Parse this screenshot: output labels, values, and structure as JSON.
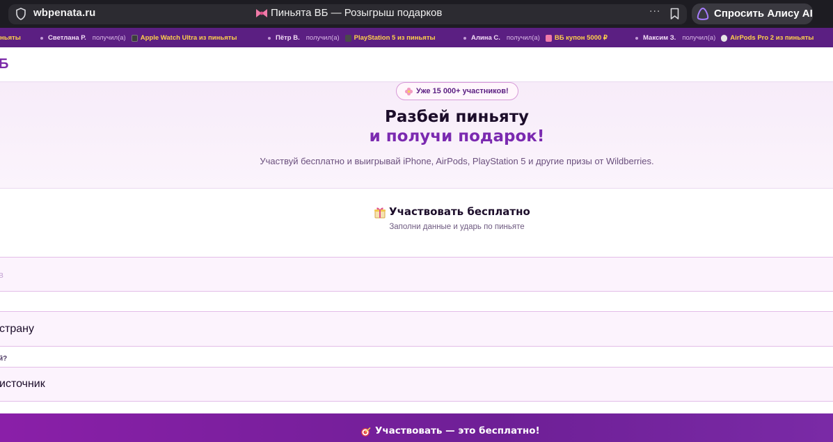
{
  "browser": {
    "url": "wbpenata.ru",
    "tab_title": "Пиньята ВБ — Розыгрыш подарков",
    "menu_dots": "···",
    "alice_button": "Спросить Алису AI"
  },
  "ticker": {
    "first_prize_fragment": "ньяты",
    "items": [
      {
        "name": "Светлана Р.",
        "action": "получил(а)",
        "prize": "Apple Watch Ultra из пиньяты",
        "icon": "watch-icon"
      },
      {
        "name": "Пётр В.",
        "action": "получил(а)",
        "prize": "PlayStation 5 из пиньяты",
        "icon": "gamepad-icon"
      },
      {
        "name": "Алина С.",
        "action": "получил(а)",
        "prize": "ВБ купон 5000 ₽",
        "icon": "shopping-bag-icon"
      },
      {
        "name": "Максим З.",
        "action": "получил(а)",
        "prize": "AirPods Pro 2 из пиньяты",
        "icon": "headphones-icon"
      }
    ]
  },
  "header": {
    "logo_fragment": "Б"
  },
  "hero": {
    "badge": "Уже 15 000+ участников!",
    "title_line1": "Разбей пиньяту",
    "title_line2": "и получи подарок!",
    "subtitle": "Участвуй бесплатно и выигрывай iPhone, AirPods, PlayStation 5 и другие призы от Wildberries."
  },
  "form": {
    "title": "Участвовать бесплатно",
    "subtitle": "Заполни данные и ударь по пиньяте",
    "name_placeholder_fragment": "в",
    "country_fragment": "страну",
    "source_label_fragment": "й?",
    "source_fragment": "источник"
  },
  "cta": {
    "label": "Участвовать — это бесплатно!"
  },
  "colors": {
    "brand_purple": "#7b2ab0",
    "ticker_bg": "#5b1f82",
    "prize_yellow": "#ffd24a"
  }
}
